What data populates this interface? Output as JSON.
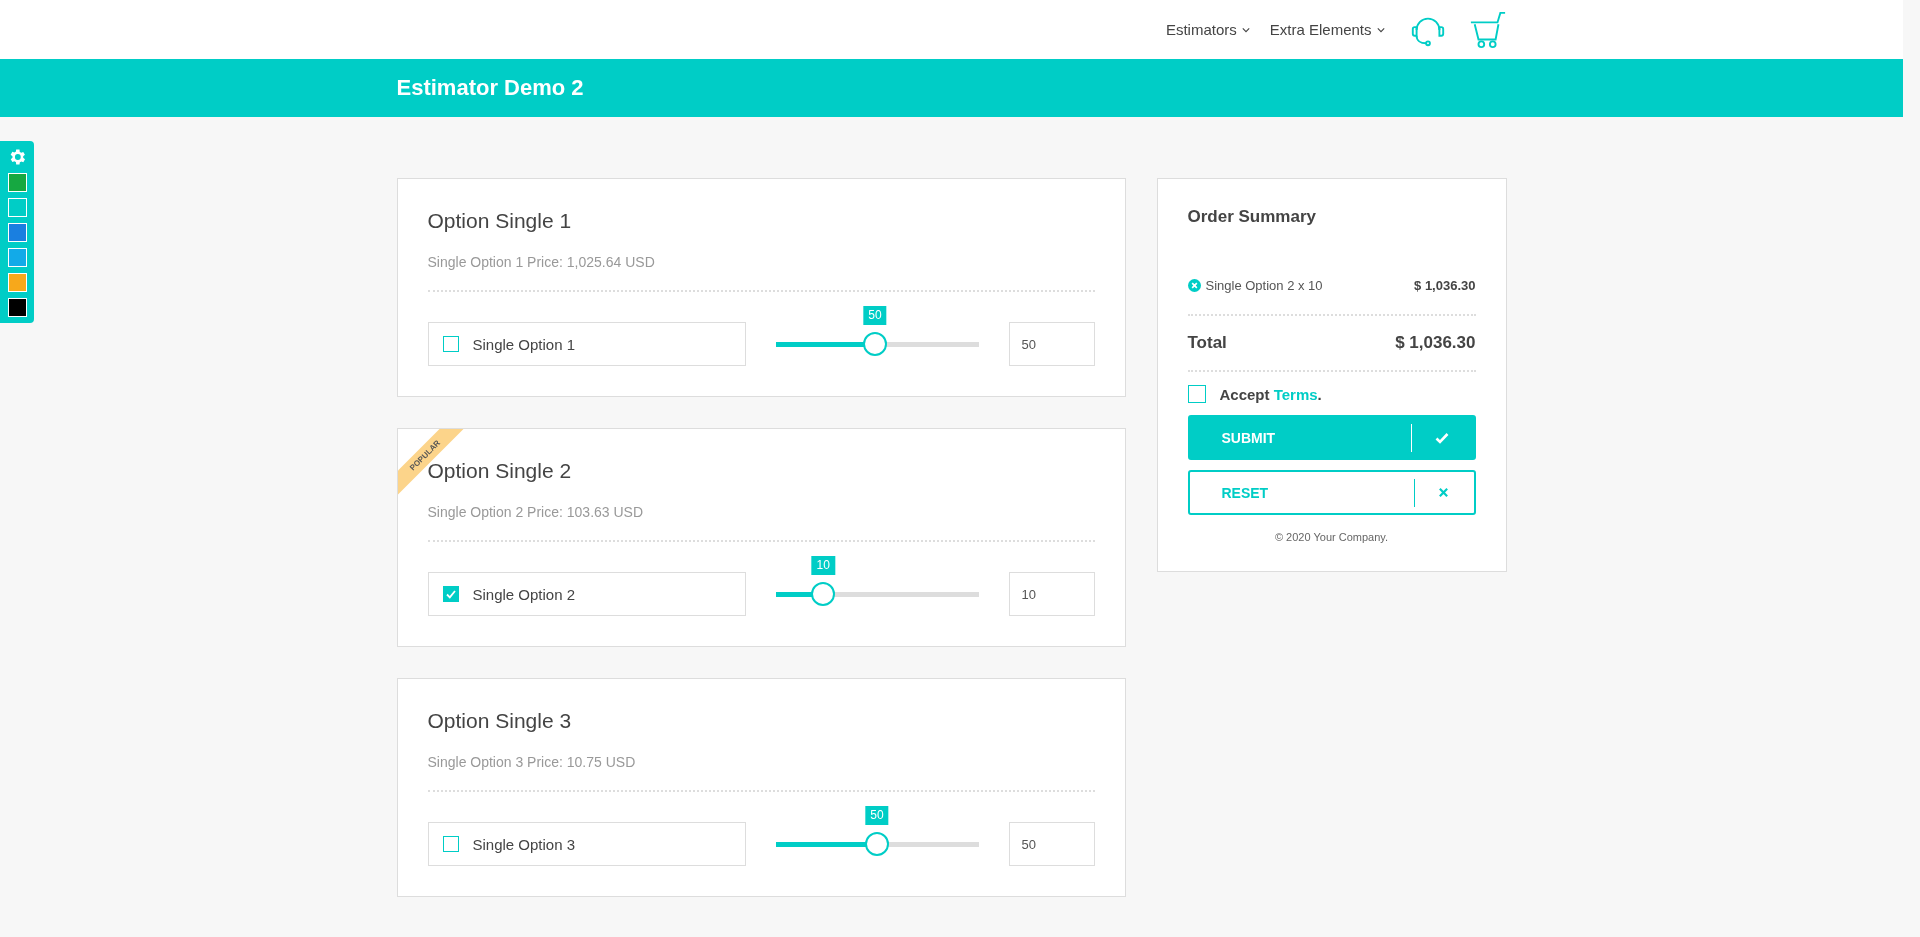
{
  "nav": [
    {
      "label": "Estimators"
    },
    {
      "label": "Extra Elements"
    }
  ],
  "banner": {
    "title": "Estimator Demo 2"
  },
  "swatches": [
    {
      "color": "#16a841"
    },
    {
      "color": "#00cdc6"
    },
    {
      "color": "#1a7fe0"
    },
    {
      "color": "#12aae8"
    },
    {
      "color": "#f7a81b"
    },
    {
      "color": "#000000"
    }
  ],
  "options": [
    {
      "title": "Option Single 1",
      "price": "Single Option 1 Price: 1,025.64 USD",
      "label": "Single Option 1",
      "checked": false,
      "level": 0.49,
      "tooltip": "50",
      "value": "50"
    },
    {
      "title": "Option Single 2",
      "ribbon": "POPULAR",
      "price": "Single Option 2 Price: 103.63 USD",
      "label": "Single Option 2",
      "checked": true,
      "level": 0.235,
      "tooltip": "10",
      "value": "10"
    },
    {
      "title": "Option Single 3",
      "price": "Single Option 3 Price: 10.75 USD",
      "label": "Single Option 3",
      "checked": false,
      "level": 0.5,
      "tooltip": "50",
      "value": "50"
    }
  ],
  "summary": {
    "title": "Order Summary",
    "items": [
      {
        "name": "Single Option 2 x 10",
        "amount": "$ 1,036.30"
      }
    ],
    "total_label": "Total",
    "total": "$ 1,036.30",
    "accept": {
      "checked": false,
      "text": "Accept",
      "link": "Terms",
      "suffix": "."
    },
    "submit": "SUBMIT",
    "reset": "RESET",
    "footer": "© 2020 Your Company."
  }
}
